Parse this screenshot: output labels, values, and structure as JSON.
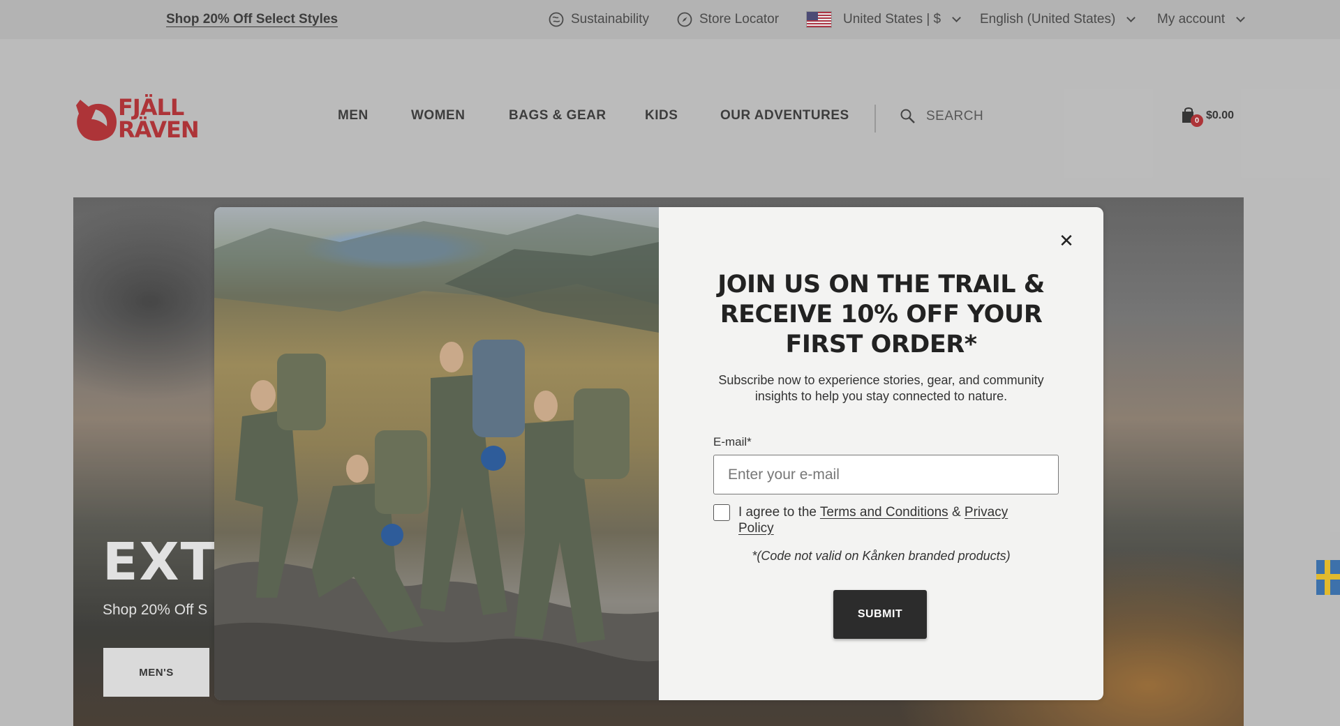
{
  "topbar": {
    "promo": "Shop 20% Off Select Styles",
    "sustainability": "Sustainability",
    "store_locator": "Store Locator",
    "country": "United States | $",
    "language": "English (United States)",
    "account": "My account"
  },
  "header": {
    "logo_line1": "FJÄLL",
    "logo_line2": "RÄVEN",
    "nav": [
      "MEN",
      "WOMEN",
      "BAGS & GEAR",
      "KIDS",
      "OUR ADVENTURES"
    ],
    "search_placeholder": "SEARCH",
    "cart_count": "0",
    "cart_total": "$0.00"
  },
  "hero": {
    "title": "EXT",
    "subtitle": "Shop 20% Off S",
    "button": "MEN'S"
  },
  "modal": {
    "title": "JOIN US ON THE TRAIL & RECEIVE 10% OFF YOUR FIRST ORDER*",
    "description": "Subscribe now to experience stories, gear, and community insights to help you stay connected to nature.",
    "email_label": "E-mail*",
    "email_placeholder": "Enter your e-mail",
    "agree_prefix": "I agree to the",
    "terms_link": "Terms and Conditions",
    "agree_mid": "&",
    "privacy_link": "Privacy Policy",
    "code_note": "*(Code not valid on Kånken branded products)",
    "submit": "SUBMIT"
  },
  "colors": {
    "brand_red": "#b31f24",
    "submit_bg": "#2c2c2c",
    "modal_bg": "#f3f3f2"
  }
}
